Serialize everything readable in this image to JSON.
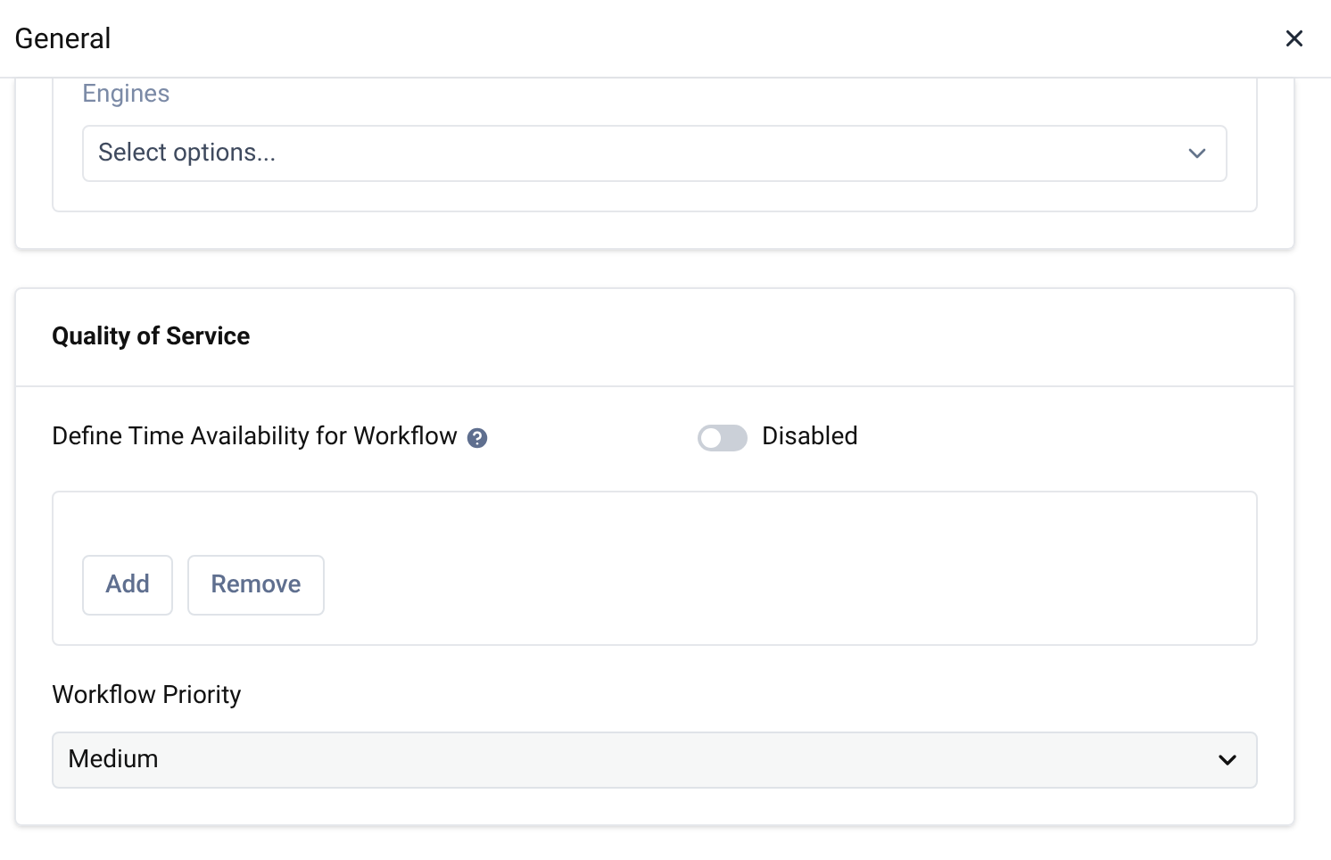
{
  "window": {
    "title": "General"
  },
  "engines": {
    "label": "Engines",
    "placeholder": "Select options..."
  },
  "quality_of_service": {
    "title": "Quality of Service",
    "time_availability": {
      "label": "Define Time Availability for Workflow",
      "on": false,
      "state_label": "Disabled"
    },
    "buttons": [
      "Add",
      "Remove"
    ],
    "priority": {
      "label": "Workflow Priority",
      "value": "Medium"
    }
  }
}
